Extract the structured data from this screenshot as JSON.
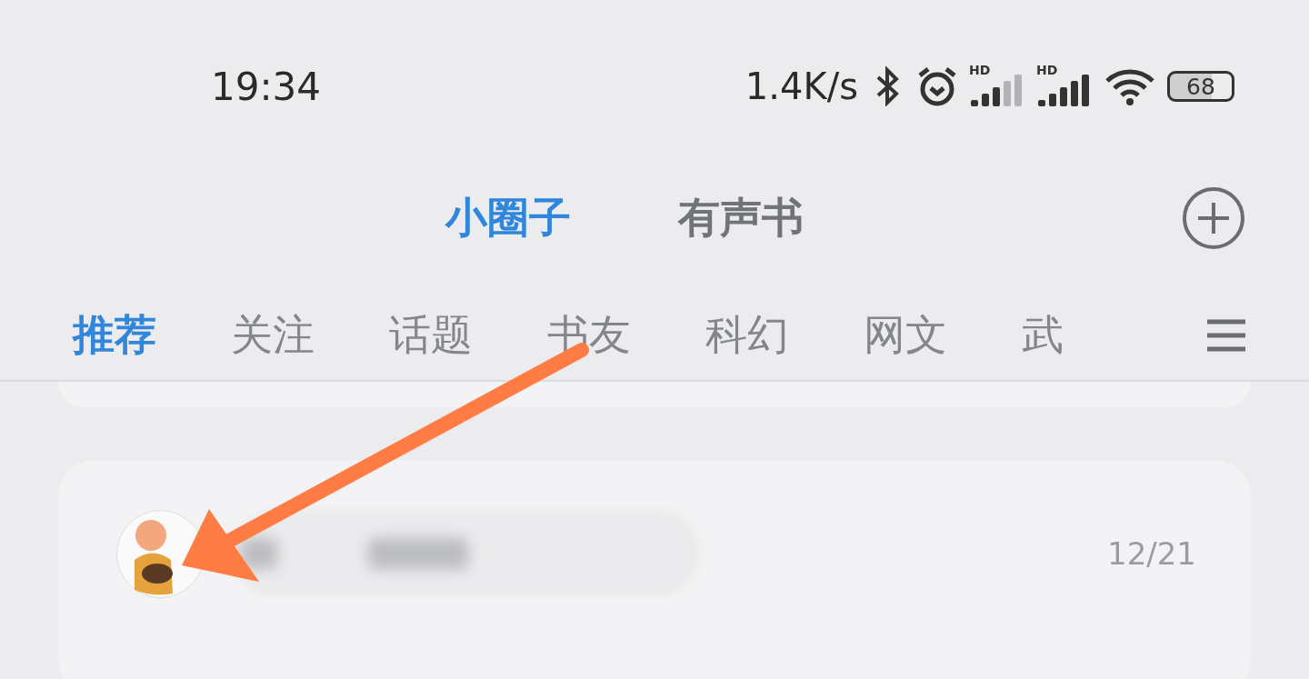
{
  "status_bar": {
    "time": "19:34",
    "speed": "1.4K/s",
    "battery": "68",
    "signals": [
      {
        "label": "HD"
      },
      {
        "label": "HD"
      }
    ]
  },
  "main_tabs": [
    {
      "label": "小圈子",
      "selected": true
    },
    {
      "label": "有声书",
      "selected": false
    }
  ],
  "category_tabs": [
    {
      "label": "推荐",
      "selected": true
    },
    {
      "label": "关注",
      "selected": false
    },
    {
      "label": "话题",
      "selected": false
    },
    {
      "label": "书友",
      "selected": false
    },
    {
      "label": "科幻",
      "selected": false
    },
    {
      "label": "网文",
      "selected": false
    },
    {
      "label": "武",
      "selected": false
    }
  ],
  "post": {
    "date": "12/21"
  }
}
